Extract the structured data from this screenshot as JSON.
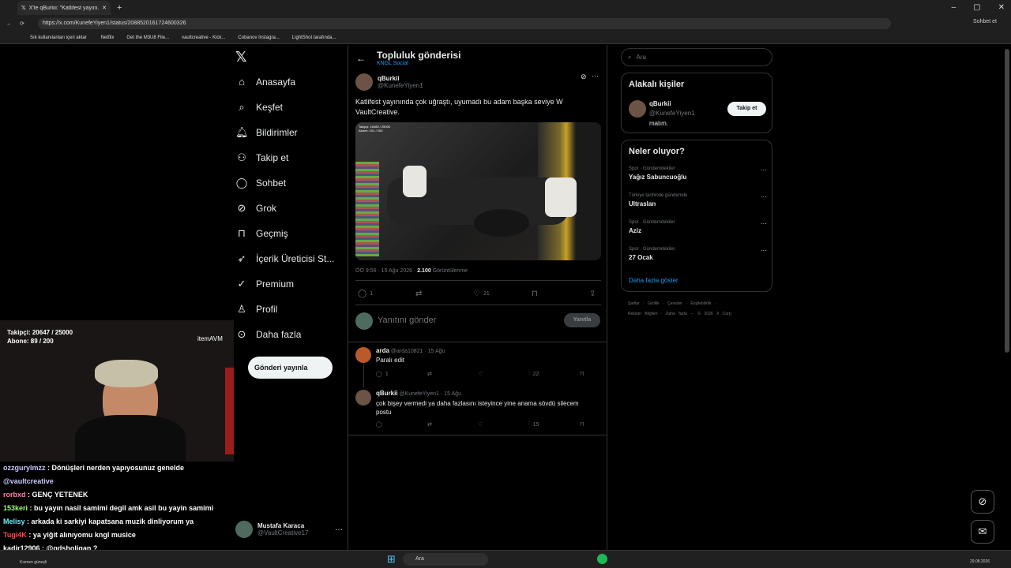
{
  "browser": {
    "tab_title": "X'te qBurkii: \"Katlifest yayını...",
    "url": "https://x.com/KunefeYiyen1/status/2088520161724600326",
    "bookmarks": [
      "Sık kullanılanları içeri aktar",
      "Netflix",
      "Get the M3U8 File...",
      "vaultcreative - Kick...",
      "Cobanov Instagra...",
      "LightShot tarafında..."
    ],
    "profile_label": "Sohbet et"
  },
  "nav": {
    "items": [
      {
        "label": "Anasayfa",
        "icon": "home-icon"
      },
      {
        "label": "Keşfet",
        "icon": "search-icon"
      },
      {
        "label": "Bildirimler",
        "icon": "bell-icon"
      },
      {
        "label": "Takip et",
        "icon": "person-add-icon"
      },
      {
        "label": "Sohbet",
        "icon": "chat-icon"
      },
      {
        "label": "Grok",
        "icon": "grok-icon"
      },
      {
        "label": "Geçmiş",
        "icon": "bookmark-icon"
      },
      {
        "label": "İçerik Üreticisi St...",
        "icon": "rocket-icon"
      },
      {
        "label": "Premium",
        "icon": "verified-icon"
      },
      {
        "label": "Profil",
        "icon": "person-icon"
      },
      {
        "label": "Daha fazla",
        "icon": "more-icon"
      }
    ],
    "post_button": "Gönderi yayınla",
    "account_name": "Mustafa Karaca",
    "account_handle": "@VaultCreative17"
  },
  "header": {
    "title": "Topluluk gönderisi",
    "subtitle": "KNGL Social"
  },
  "post": {
    "author": "qBurkii",
    "handle": "@KunefeYiyen1",
    "text": "Katlifest yayınında çok uğraştı, uyumadı bu adam başka seviye W VaultCreative.",
    "time": "ÖÖ 9:56 · 15 Ağu 2026 · ",
    "views": "2.100",
    "views_label": " Görüntülenme",
    "replies": "1",
    "likes": "21",
    "image_overlay": "Takipçi: 16466 / 25000\nAbone: 101 / 200"
  },
  "reply_box": {
    "placeholder": "Yanıtını gönder",
    "button": "Yanıtla"
  },
  "replies": [
    {
      "author": "arda",
      "meta": "@arda10821 · 15 Ağu",
      "text": "Paralı edit",
      "replies": "1",
      "views": "22"
    },
    {
      "author": "qBurkii",
      "meta": "@KunefeYiyen1 · 15 Ağu",
      "text": "çok bişey vermedi ya daha fazlasını isteyince yine anama sövdü silecem postu",
      "views": "15"
    }
  ],
  "search": {
    "placeholder": "Ara"
  },
  "related": {
    "title": "Alakalı kişiler",
    "name": "qBurkii",
    "handle": "@KunefeYiyen1",
    "bio": "malım.",
    "follow": "Takip et"
  },
  "trends": {
    "title": "Neler oluyor?",
    "items": [
      {
        "context": "Spor · Gündemdekiler",
        "name": "Yağız Sabuncuoğlu"
      },
      {
        "context": "Türkiye tarihinde gündemde",
        "name": "Ultraslan"
      },
      {
        "context": "Spor · Gündemdekiler",
        "name": "Aziz"
      },
      {
        "context": "Spor · Gündemdekiler",
        "name": "27 Ocak"
      }
    ],
    "more": "Daha fazla göster"
  },
  "footer": {
    "line1": "Şartlar · Gizlilik · Çerezler · Erişilebilirlik ·",
    "line2": "Reklam Bilgileri · Daha fazla ··· © 2026 X Corp."
  },
  "stream": {
    "followers": "Takipçi: 20647 / 25000",
    "subs": "Abone: 89 / 200",
    "sponsor": "itemAVM"
  },
  "chat": [
    {
      "user": "ozzgurylmzz",
      "color": "#c9c9ff",
      "msg": " : Dönüşleri nerden yapıyosunuz genelde"
    },
    {
      "user": "",
      "color": "#c9c9ff",
      "msg": "@vaultcreative",
      "mention": true
    },
    {
      "user": "rorbxd",
      "color": "#ff7fb0",
      "msg": " : GENÇ YETENEK"
    },
    {
      "user": "153keri",
      "color": "#9cff6b",
      "msg": " : bu yayın nasil samimi degil amk asil bu yayin samimi"
    },
    {
      "user": "Melisy",
      "color": "#6bf0ff",
      "msg": " : arkada ki sarkiyi kapatsana muzik dinliyorum ya"
    },
    {
      "user": "Tugi4K",
      "color": "#ff4d4d",
      "msg": " : ya yiğit alınıyomu kngl musice"
    },
    {
      "user": "kadir12906",
      "color": "#ffffff",
      "msg": " : @gdsholigan ?"
    }
  ],
  "taskbar": {
    "search": "Ara",
    "weather": "Kısmen güneşli",
    "date": "29.08.2026"
  }
}
